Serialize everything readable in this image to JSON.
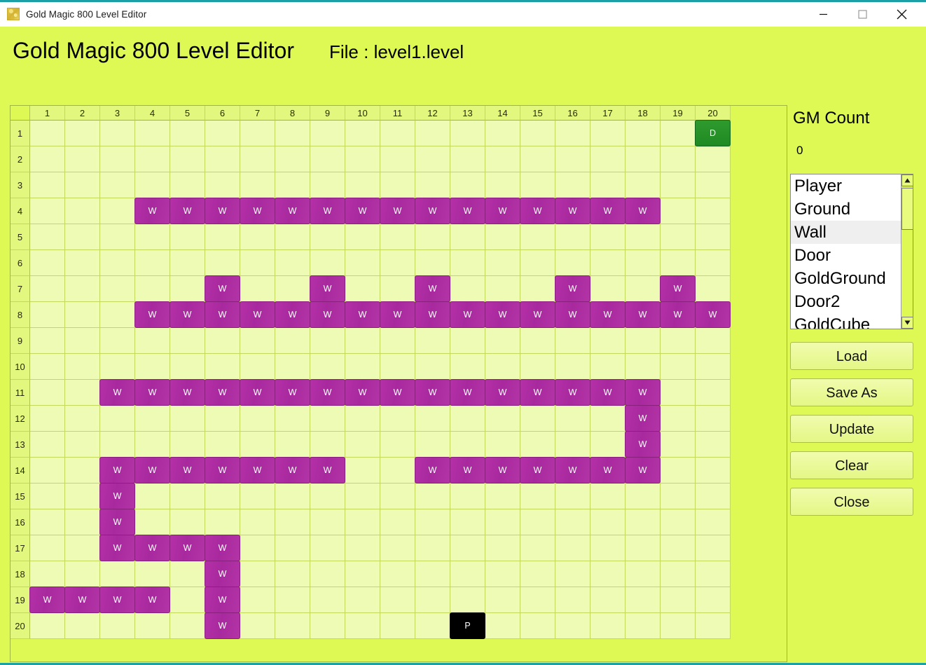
{
  "window": {
    "title": "Gold Magic 800 Level Editor",
    "icon": "gold-magic-app-icon",
    "accent_color": "#1CA0A8",
    "background_color": "#DEF953",
    "controls": {
      "minimize": "minimize-icon",
      "maximize": "maximize-icon",
      "close": "close-icon"
    }
  },
  "header": {
    "app_title": "Gold Magic 800 Level Editor",
    "file_label": "File : level1.level"
  },
  "grid": {
    "columns": 20,
    "rows": 20,
    "column_headers": [
      "1",
      "2",
      "3",
      "4",
      "5",
      "6",
      "7",
      "8",
      "9",
      "10",
      "11",
      "12",
      "13",
      "14",
      "15",
      "16",
      "17",
      "18",
      "19",
      "20"
    ],
    "row_headers": [
      "1",
      "2",
      "3",
      "4",
      "5",
      "6",
      "7",
      "8",
      "9",
      "10",
      "11",
      "12",
      "13",
      "14",
      "15",
      "16",
      "17",
      "18",
      "19",
      "20"
    ],
    "empty_color": "#EEFBB4",
    "wall_color": "#B12FA6",
    "door_color": "#2A9427",
    "player_color": "#000000",
    "tile_labels": {
      "wall": "W",
      "door": "D",
      "player": "P"
    },
    "tiles": [
      {
        "row": 1,
        "col": 20,
        "type": "door"
      },
      {
        "row": 4,
        "col": 4,
        "type": "wall"
      },
      {
        "row": 4,
        "col": 5,
        "type": "wall"
      },
      {
        "row": 4,
        "col": 6,
        "type": "wall"
      },
      {
        "row": 4,
        "col": 7,
        "type": "wall"
      },
      {
        "row": 4,
        "col": 8,
        "type": "wall"
      },
      {
        "row": 4,
        "col": 9,
        "type": "wall"
      },
      {
        "row": 4,
        "col": 10,
        "type": "wall"
      },
      {
        "row": 4,
        "col": 11,
        "type": "wall"
      },
      {
        "row": 4,
        "col": 12,
        "type": "wall"
      },
      {
        "row": 4,
        "col": 13,
        "type": "wall"
      },
      {
        "row": 4,
        "col": 14,
        "type": "wall"
      },
      {
        "row": 4,
        "col": 15,
        "type": "wall"
      },
      {
        "row": 4,
        "col": 16,
        "type": "wall"
      },
      {
        "row": 4,
        "col": 17,
        "type": "wall"
      },
      {
        "row": 4,
        "col": 18,
        "type": "wall"
      },
      {
        "row": 7,
        "col": 6,
        "type": "wall"
      },
      {
        "row": 7,
        "col": 9,
        "type": "wall"
      },
      {
        "row": 7,
        "col": 12,
        "type": "wall"
      },
      {
        "row": 7,
        "col": 16,
        "type": "wall"
      },
      {
        "row": 7,
        "col": 19,
        "type": "wall"
      },
      {
        "row": 8,
        "col": 4,
        "type": "wall"
      },
      {
        "row": 8,
        "col": 5,
        "type": "wall"
      },
      {
        "row": 8,
        "col": 6,
        "type": "wall"
      },
      {
        "row": 8,
        "col": 7,
        "type": "wall"
      },
      {
        "row": 8,
        "col": 8,
        "type": "wall"
      },
      {
        "row": 8,
        "col": 9,
        "type": "wall"
      },
      {
        "row": 8,
        "col": 10,
        "type": "wall"
      },
      {
        "row": 8,
        "col": 11,
        "type": "wall"
      },
      {
        "row": 8,
        "col": 12,
        "type": "wall"
      },
      {
        "row": 8,
        "col": 13,
        "type": "wall"
      },
      {
        "row": 8,
        "col": 14,
        "type": "wall"
      },
      {
        "row": 8,
        "col": 15,
        "type": "wall"
      },
      {
        "row": 8,
        "col": 16,
        "type": "wall"
      },
      {
        "row": 8,
        "col": 17,
        "type": "wall"
      },
      {
        "row": 8,
        "col": 18,
        "type": "wall"
      },
      {
        "row": 8,
        "col": 19,
        "type": "wall"
      },
      {
        "row": 8,
        "col": 20,
        "type": "wall"
      },
      {
        "row": 11,
        "col": 3,
        "type": "wall"
      },
      {
        "row": 11,
        "col": 4,
        "type": "wall"
      },
      {
        "row": 11,
        "col": 5,
        "type": "wall"
      },
      {
        "row": 11,
        "col": 6,
        "type": "wall"
      },
      {
        "row": 11,
        "col": 7,
        "type": "wall"
      },
      {
        "row": 11,
        "col": 8,
        "type": "wall"
      },
      {
        "row": 11,
        "col": 9,
        "type": "wall"
      },
      {
        "row": 11,
        "col": 10,
        "type": "wall"
      },
      {
        "row": 11,
        "col": 11,
        "type": "wall"
      },
      {
        "row": 11,
        "col": 12,
        "type": "wall"
      },
      {
        "row": 11,
        "col": 13,
        "type": "wall"
      },
      {
        "row": 11,
        "col": 14,
        "type": "wall"
      },
      {
        "row": 11,
        "col": 15,
        "type": "wall"
      },
      {
        "row": 11,
        "col": 16,
        "type": "wall"
      },
      {
        "row": 11,
        "col": 17,
        "type": "wall"
      },
      {
        "row": 11,
        "col": 18,
        "type": "wall"
      },
      {
        "row": 12,
        "col": 18,
        "type": "wall"
      },
      {
        "row": 13,
        "col": 18,
        "type": "wall"
      },
      {
        "row": 14,
        "col": 3,
        "type": "wall"
      },
      {
        "row": 14,
        "col": 4,
        "type": "wall"
      },
      {
        "row": 14,
        "col": 5,
        "type": "wall"
      },
      {
        "row": 14,
        "col": 6,
        "type": "wall"
      },
      {
        "row": 14,
        "col": 7,
        "type": "wall"
      },
      {
        "row": 14,
        "col": 8,
        "type": "wall"
      },
      {
        "row": 14,
        "col": 9,
        "type": "wall"
      },
      {
        "row": 14,
        "col": 12,
        "type": "wall"
      },
      {
        "row": 14,
        "col": 13,
        "type": "wall"
      },
      {
        "row": 14,
        "col": 14,
        "type": "wall"
      },
      {
        "row": 14,
        "col": 15,
        "type": "wall"
      },
      {
        "row": 14,
        "col": 16,
        "type": "wall"
      },
      {
        "row": 14,
        "col": 17,
        "type": "wall"
      },
      {
        "row": 14,
        "col": 18,
        "type": "wall"
      },
      {
        "row": 15,
        "col": 3,
        "type": "wall"
      },
      {
        "row": 16,
        "col": 3,
        "type": "wall"
      },
      {
        "row": 17,
        "col": 3,
        "type": "wall"
      },
      {
        "row": 17,
        "col": 4,
        "type": "wall"
      },
      {
        "row": 17,
        "col": 5,
        "type": "wall"
      },
      {
        "row": 17,
        "col": 6,
        "type": "wall"
      },
      {
        "row": 18,
        "col": 6,
        "type": "wall"
      },
      {
        "row": 19,
        "col": 1,
        "type": "wall"
      },
      {
        "row": 19,
        "col": 2,
        "type": "wall"
      },
      {
        "row": 19,
        "col": 3,
        "type": "wall"
      },
      {
        "row": 19,
        "col": 4,
        "type": "wall"
      },
      {
        "row": 19,
        "col": 6,
        "type": "wall"
      },
      {
        "row": 20,
        "col": 6,
        "type": "wall"
      },
      {
        "row": 20,
        "col": 13,
        "type": "player"
      }
    ]
  },
  "side_panel": {
    "gm_count_label": "GM Count",
    "gm_count_value": "0",
    "tile_list": {
      "items": [
        "Player",
        "Ground",
        "Wall",
        "Door",
        "GoldGround",
        "Door2",
        "GoldCube"
      ],
      "selected": "Wall",
      "scroll_up_icon": "triangle-up-icon",
      "scroll_down_icon": "triangle-down-icon"
    },
    "buttons": [
      {
        "label": "Load",
        "name": "load-button"
      },
      {
        "label": "Save As",
        "name": "save-as-button"
      },
      {
        "label": "Update",
        "name": "update-button"
      },
      {
        "label": "Clear",
        "name": "clear-button"
      },
      {
        "label": "Close",
        "name": "close-button"
      }
    ]
  }
}
